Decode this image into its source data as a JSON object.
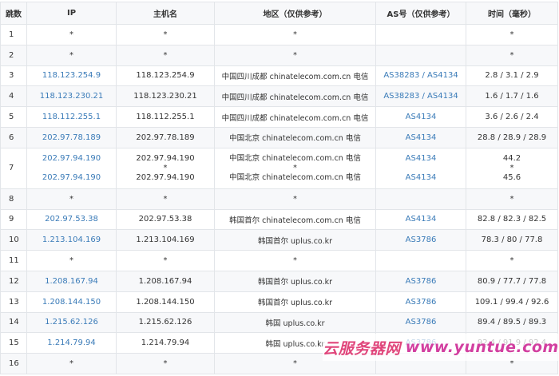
{
  "columns": {
    "hop": "跳数",
    "ip": "IP",
    "hostname": "主机名",
    "location": "地区（仅供参考）",
    "as": "AS号（仅供参考）",
    "time": "时间（毫秒）"
  },
  "rows": [
    {
      "hop": "1",
      "ip": "*",
      "hostname": "*",
      "location": "*",
      "as": "",
      "time": "*"
    },
    {
      "hop": "2",
      "ip": "*",
      "hostname": "*",
      "location": "*",
      "as": "",
      "time": "*"
    },
    {
      "hop": "3",
      "ip": "118.123.254.9",
      "hostname": "118.123.254.9",
      "location": "中国四川成都 chinatelecom.com.cn 电信",
      "as": "AS38283 / AS4134",
      "time": "2.8 / 3.1 / 2.9"
    },
    {
      "hop": "4",
      "ip": "118.123.230.21",
      "hostname": "118.123.230.21",
      "location": "中国四川成都 chinatelecom.com.cn 电信",
      "as": "AS38283 / AS4134",
      "time": "1.6 / 1.7 / 1.6"
    },
    {
      "hop": "5",
      "ip": "118.112.255.1",
      "hostname": "118.112.255.1",
      "location": "中国四川成都 chinatelecom.com.cn 电信",
      "as": "AS4134",
      "time": "3.6 / 2.6 / 2.4"
    },
    {
      "hop": "6",
      "ip": "202.97.78.189",
      "hostname": "202.97.78.189",
      "location": "中国北京 chinatelecom.com.cn 电信",
      "as": "AS4134",
      "time": "28.8 / 28.9 / 28.9"
    },
    {
      "hop": "7",
      "ip": [
        "202.97.94.190",
        "",
        "202.97.94.190"
      ],
      "hostname": [
        "202.97.94.190",
        "*",
        "202.97.94.190"
      ],
      "location": [
        "中国北京 chinatelecom.com.cn 电信",
        "*",
        "中国北京 chinatelecom.com.cn 电信"
      ],
      "as": [
        "AS4134",
        "",
        "AS4134"
      ],
      "time": [
        "44.2",
        "*",
        "45.6"
      ]
    },
    {
      "hop": "8",
      "ip": "*",
      "hostname": "*",
      "location": "*",
      "as": "",
      "time": "*"
    },
    {
      "hop": "9",
      "ip": "202.97.53.38",
      "hostname": "202.97.53.38",
      "location": "韩国首尔 chinatelecom.com.cn 电信",
      "as": "AS4134",
      "time": "82.8 / 82.3 / 82.5"
    },
    {
      "hop": "10",
      "ip": "1.213.104.169",
      "hostname": "1.213.104.169",
      "location": "韩国首尔 uplus.co.kr",
      "as": "AS3786",
      "time": "78.3 / 80 / 77.8"
    },
    {
      "hop": "11",
      "ip": "*",
      "hostname": "*",
      "location": "*",
      "as": "",
      "time": "*"
    },
    {
      "hop": "12",
      "ip": "1.208.167.94",
      "hostname": "1.208.167.94",
      "location": "韩国首尔 uplus.co.kr",
      "as": "AS3786",
      "time": "80.9 / 77.7 / 77.8"
    },
    {
      "hop": "13",
      "ip": "1.208.144.150",
      "hostname": "1.208.144.150",
      "location": "韩国首尔 uplus.co.kr",
      "as": "AS3786",
      "time": "109.1 / 99.4 / 92.6"
    },
    {
      "hop": "14",
      "ip": "1.215.62.126",
      "hostname": "1.215.62.126",
      "location": "韩国 uplus.co.kr",
      "as": "AS3786",
      "time": "89.4 / 89.5 / 89.3"
    },
    {
      "hop": "15",
      "ip": "1.214.79.94",
      "hostname": "1.214.79.94",
      "location": "韩国 uplus.co.kr",
      "as": "AS3786",
      "time": "92.4 / 91.9 / 92.4"
    },
    {
      "hop": "16",
      "ip": "*",
      "hostname": "*",
      "location": "*",
      "as": "",
      "time": "*"
    }
  ],
  "watermark": {
    "text_cn": "云服务器网",
    "text_url": "www.yuntue.com",
    "color_cn": "#e0457b",
    "color_url": "#d23fa0"
  },
  "colors": {
    "header_bg": "#f7f8fa",
    "border": "#e2e5e9",
    "link": "#3a7bb8",
    "text": "#333333"
  }
}
